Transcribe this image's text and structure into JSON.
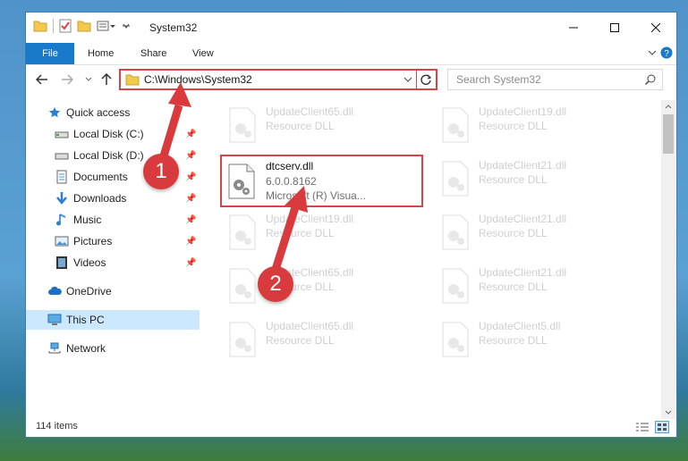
{
  "window": {
    "title": "System32"
  },
  "ribbon": {
    "tabs": [
      "File",
      "Home",
      "Share",
      "View"
    ]
  },
  "address": {
    "path": "C:\\Windows\\System32"
  },
  "search": {
    "placeholder": "Search System32"
  },
  "nav": {
    "items": [
      {
        "label": "Quick access",
        "icon": "star-icon"
      },
      {
        "label": "Local Disk (C:)",
        "icon": "drive-icon"
      },
      {
        "label": "Local Disk (D:)",
        "icon": "drive-icon"
      },
      {
        "label": "Documents",
        "icon": "documents-icon"
      },
      {
        "label": "Downloads",
        "icon": "downloads-icon"
      },
      {
        "label": "Music",
        "icon": "music-icon"
      },
      {
        "label": "Pictures",
        "icon": "pictures-icon"
      },
      {
        "label": "Videos",
        "icon": "videos-icon"
      },
      {
        "label": "OneDrive",
        "icon": "cloud-icon"
      },
      {
        "label": "This PC",
        "icon": "computer-icon"
      },
      {
        "label": "Network",
        "icon": "network-icon"
      }
    ]
  },
  "files": {
    "highlighted": {
      "name": "dtcserv.dll",
      "version": "6.0.0.8162",
      "company": "Microsoft (R) Visua..."
    },
    "background": [
      {
        "name": "UpdateClient65.dll",
        "type": "Resource DLL"
      },
      {
        "name": "UpdateClient19.dll",
        "type": "Resource DLL"
      },
      {
        "name": "UpdateClient21.dll",
        "type": "Resource DLL"
      },
      {
        "name": "UpdateClient19.dll",
        "type": "Resource DLL"
      },
      {
        "name": "UpdateClient21.dll",
        "type": "Resource DLL"
      },
      {
        "name": "UpdateClient65.dll",
        "type": "Resource DLL"
      },
      {
        "name": "UpdateClient21.dll",
        "type": "Resource DLL"
      },
      {
        "name": "UpdateClient65.dll",
        "type": "Resource DLL"
      },
      {
        "name": "UpdateClient5.dll",
        "type": "Resource DLL"
      }
    ]
  },
  "status": {
    "count": "114 items"
  },
  "annotations": {
    "step1": "1",
    "step2": "2"
  },
  "colors": {
    "accent": "#1979ca",
    "annotation": "#d83a3d",
    "selection": "#cce8ff"
  }
}
